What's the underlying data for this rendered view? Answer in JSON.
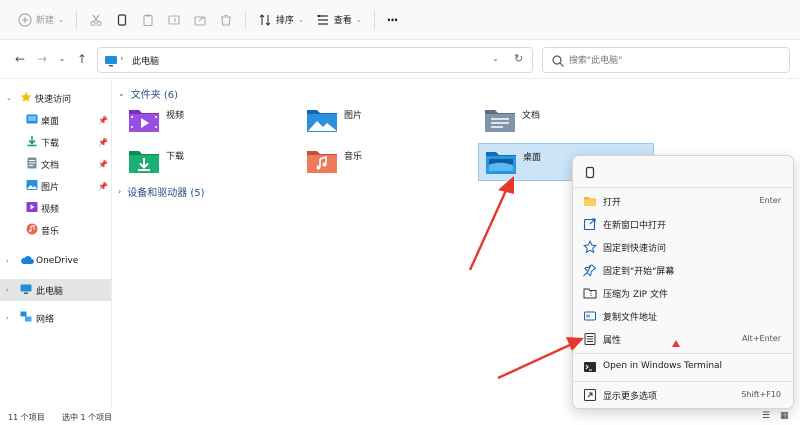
{
  "toolbar": {
    "new_label": "新建",
    "sort_label": "排序",
    "view_label": "查看",
    "more_label": "···"
  },
  "address": {
    "path": "此电脑",
    "search_placeholder": "搜索\"此电脑\""
  },
  "sidebar": {
    "quick_access": "快速访问",
    "items": [
      {
        "label": "桌面"
      },
      {
        "label": "下载"
      },
      {
        "label": "文档"
      },
      {
        "label": "图片"
      },
      {
        "label": "视频"
      },
      {
        "label": "音乐"
      }
    ],
    "onedrive": "OneDrive",
    "this_pc": "此电脑",
    "network": "网络"
  },
  "main": {
    "folders_header": "文件夹 (6)",
    "devices_header": "设备和驱动器 (5)",
    "folders": [
      {
        "name": "视频"
      },
      {
        "name": "图片"
      },
      {
        "name": "文档"
      },
      {
        "name": "下载"
      },
      {
        "name": "音乐"
      },
      {
        "name": "桌面"
      }
    ]
  },
  "status": {
    "count": "11 个项目",
    "selected": "选中 1 个项目"
  },
  "context_menu": {
    "items": [
      {
        "label": "打开",
        "shortcut": "Enter"
      },
      {
        "label": "在新窗口中打开",
        "shortcut": ""
      },
      {
        "label": "固定到快速访问",
        "shortcut": ""
      },
      {
        "label": "固定到\"开始\"屏幕",
        "shortcut": ""
      },
      {
        "label": "压缩为 ZIP 文件",
        "shortcut": ""
      },
      {
        "label": "复制文件地址",
        "shortcut": ""
      },
      {
        "label": "属性",
        "shortcut": "Alt+Enter"
      },
      {
        "label": "Open in Windows Terminal",
        "shortcut": ""
      },
      {
        "label": "显示更多选项",
        "shortcut": "Shift+F10"
      }
    ]
  },
  "colors": {
    "accent": "#0067c0",
    "selection": "#cce4f7",
    "annotation": "#e8352e"
  }
}
